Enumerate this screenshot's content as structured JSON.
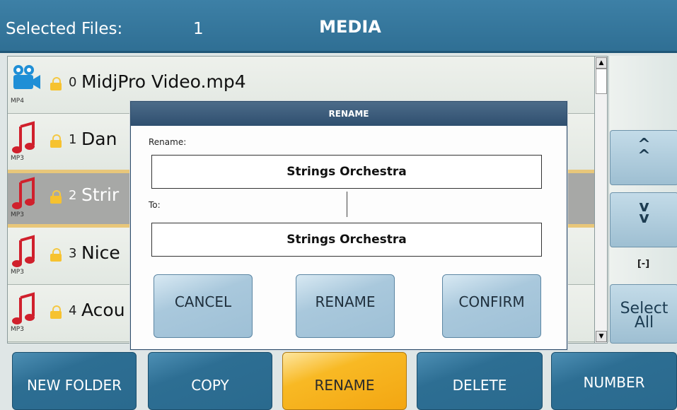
{
  "header": {
    "selected_label": "Selected Files:",
    "selected_count": "1",
    "title": "MEDIA"
  },
  "files": [
    {
      "index": "0",
      "name": "MidjPro Video.mp4",
      "type": "MP4",
      "icon": "video-camera-icon",
      "selected": false
    },
    {
      "index": "1",
      "name": "Dan",
      "type": "MP3",
      "icon": "music-note-icon",
      "selected": false
    },
    {
      "index": "2",
      "name": "Strir",
      "type": "MP3",
      "icon": "music-note-icon",
      "selected": true
    },
    {
      "index": "3",
      "name": "Nice",
      "type": "MP3",
      "icon": "music-note-icon",
      "selected": false
    },
    {
      "index": "4",
      "name": "Acou",
      "type": "MP3",
      "icon": "music-note-icon",
      "selected": false
    }
  ],
  "side": {
    "up_glyph": "^\n^",
    "down_glyph": "v\nv",
    "selection_indicator": "[-]",
    "select_all_label": "Select\nAll"
  },
  "bottom_buttons": [
    {
      "label": "NEW FOLDER",
      "active": false
    },
    {
      "label": "COPY",
      "active": false
    },
    {
      "label": "RENAME",
      "active": true
    },
    {
      "label": "DELETE",
      "active": false
    },
    {
      "label": "NUMBER",
      "active": false
    }
  ],
  "dialog": {
    "title": "RENAME",
    "rename_label": "Rename:",
    "rename_value": "Strings Orchestra",
    "to_label": "To:",
    "to_value": "Strings Orchestra",
    "cancel_label": "CANCEL",
    "rename_button_label": "RENAME",
    "confirm_label": "CONFIRM"
  },
  "colors": {
    "header": "#2f6f94",
    "active_button": "#f8b924",
    "music_icon": "#d0202c",
    "video_icon": "#1f8fd6"
  }
}
